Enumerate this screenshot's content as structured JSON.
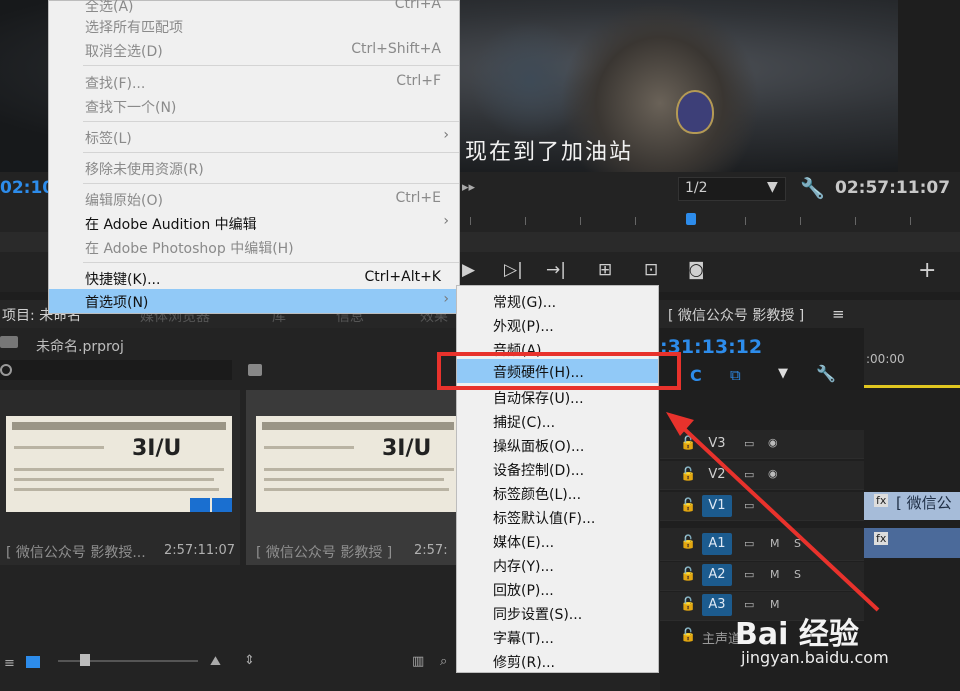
{
  "monitor": {
    "subtitle": "现在到了加油站",
    "timecode_left": "02:10",
    "zoom": "1/2",
    "timecode_right": "02:57:11:07",
    "add_button": "+"
  },
  "project_panel": {
    "title": "项目: 未命名",
    "tabs": [
      "媒体浏览器",
      "库",
      "信息",
      "效果"
    ],
    "file_name": "未命名.prproj",
    "clips": [
      {
        "label": "[ 微信公众号 影教授...",
        "duration": "2:57:11:07"
      },
      {
        "label": "[ 微信公众号 影教授 ]",
        "duration": "2:57:"
      }
    ],
    "thumbnail_text": "3I/U"
  },
  "timeline": {
    "sequence_title": "[ 微信公众号 影教授 ]",
    "menu_icon": "≡",
    "timecode": ":31:13:12",
    "ruler_tc": ":00:00",
    "tracks": [
      {
        "name": "V3",
        "active": false
      },
      {
        "name": "V2",
        "active": false
      },
      {
        "name": "V1",
        "active": true
      },
      {
        "name": "A1",
        "active": true
      },
      {
        "name": "A2",
        "active": false
      },
      {
        "name": "A3",
        "active": false
      }
    ],
    "master_label": "主声道",
    "clip_v1_label": "[ 微信公",
    "m_label": "M",
    "s_label": "S",
    "fx_label": "fx"
  },
  "edit_menu": {
    "items": [
      {
        "label": "全选(A)",
        "shortcut": "Ctrl+A",
        "state": "disabled"
      },
      {
        "label": "选择所有匹配项",
        "shortcut": "",
        "state": "disabled"
      },
      {
        "label": "取消全选(D)",
        "shortcut": "Ctrl+Shift+A",
        "state": "disabled"
      },
      {
        "label": "查找(F)...",
        "shortcut": "Ctrl+F",
        "state": "disabled"
      },
      {
        "label": "查找下一个(N)",
        "shortcut": "",
        "state": "disabled"
      },
      {
        "label": "标签(L)",
        "shortcut": "",
        "state": "disabled"
      },
      {
        "label": "移除未使用资源(R)",
        "shortcut": "",
        "state": "disabled"
      },
      {
        "label": "编辑原始(O)",
        "shortcut": "Ctrl+E",
        "state": "disabled"
      },
      {
        "label": "在 Adobe Audition 中编辑",
        "shortcut": "",
        "state": "enabled"
      },
      {
        "label": "在 Adobe Photoshop 中编辑(H)",
        "shortcut": "",
        "state": "disabled"
      },
      {
        "label": "快捷键(K)...",
        "shortcut": "Ctrl+Alt+K",
        "state": "enabled"
      },
      {
        "label": "首选项(N)",
        "shortcut": "",
        "state": "highlighted"
      }
    ]
  },
  "preferences_submenu": {
    "items": [
      "常规(G)...",
      "外观(P)...",
      "音频(A)...",
      "音频硬件(H)...",
      "自动保存(U)...",
      "捕捉(C)...",
      "操纵面板(O)...",
      "设备控制(D)...",
      "标签颜色(L)...",
      "标签默认值(F)...",
      "媒体(E)...",
      "内存(Y)...",
      "回放(P)...",
      "同步设置(S)...",
      "字幕(T)...",
      "修剪(R)..."
    ],
    "highlighted_index": 3
  },
  "watermark": {
    "brand": "Bai  经验",
    "domain": "jingyan.baidu.com"
  },
  "colors": {
    "accent_blue": "#2d8ceb",
    "menu_highlight": "#91c9f7",
    "annotation_red": "#e8322c"
  }
}
